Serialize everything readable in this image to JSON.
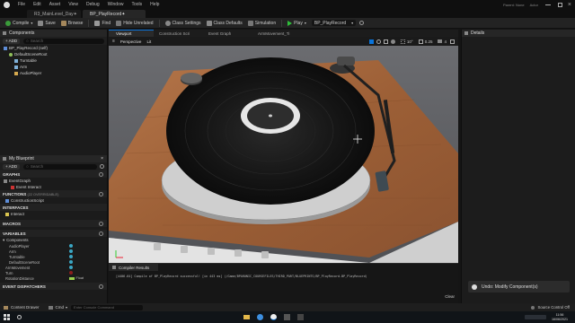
{
  "menubar": {
    "items": [
      "File",
      "Edit",
      "Asset",
      "View",
      "Debug",
      "Window",
      "Tools",
      "Help"
    ],
    "parent_label": "Parent: None",
    "user_badge": "Actor"
  },
  "doc_tabs": [
    "R3_MainLevel_Day✦",
    "BP_PlayRecord✦"
  ],
  "toolbar": {
    "compile": "Compile",
    "save": "Save",
    "browse": "Browse",
    "find": "Find",
    "hide_unrelated": "Hide Unrelated",
    "class_settings": "Class Settings",
    "class_defaults": "Class Defaults",
    "simulation": "Simulation",
    "play": "Play",
    "debug_object": "BP_PlayRecord"
  },
  "components_panel": {
    "title": "Components",
    "add_label": "+ ADD",
    "search_placeholder": "Search",
    "items": [
      "BP_PlayRecord (self)",
      "DefaultSceneRoot",
      "Turntable",
      "Arm",
      "AudioPlayer"
    ]
  },
  "my_blueprint": {
    "title": "My Blueprint",
    "add_label": "+ ADD",
    "search_placeholder": "Search",
    "graphs_label": "GRAPHS",
    "event_graph": "EventGraph",
    "event_interact": "Event Interact",
    "functions_label": "FUNCTIONS",
    "functions_count": "(22 OVERRIDABLE)",
    "construction_script": "ConstructionScript",
    "interfaces_label": "INTERFACES",
    "interact": "Interact",
    "macros_label": "MACROS",
    "variables_label": "VARIABLES",
    "components_label": "Components",
    "variables": [
      "AudioPlayer",
      "Arm",
      "Turntable",
      "DefaultSceneRoot",
      "ArmMovement",
      "Turn",
      "RotationDistance"
    ],
    "variable_type": "Float",
    "event_dispatchers_label": "EVENT DISPATCHERS"
  },
  "editor_tabs": [
    "Viewport",
    "Construction Scri",
    "Event Graph",
    "ArmMovement_Ti"
  ],
  "viewport": {
    "perspective": "Perspective",
    "lit": "Lit",
    "angle": "10°",
    "scale": "0.25",
    "camera_speed": "4"
  },
  "compiler": {
    "tab_label": "Compiler Results",
    "message": "[4406.64] Compile of BP_PlayRecord successful! [in 443 ms] (/Game/BPARONIC_COURSEFILES/THIRD_PART/BLUEPRINTS/BP_PlayRecord.BP_PlayRecord)",
    "clear_label": "Clear"
  },
  "details_panel": {
    "title": "Details"
  },
  "toast": {
    "text": "Undo: Modify Component(s)"
  },
  "bottombar": {
    "content_drawer": "Content Drawer",
    "cmd": "Cmd",
    "console_placeholder": "Enter Console Command",
    "source_control": "Source Control Off"
  },
  "taskbar": {
    "time": "11:56",
    "date": "16/06/2021"
  },
  "colors": {
    "accent": "#0a74da",
    "play_green": "#2fbf3a",
    "panel": "#1b1b1b",
    "wood": "#a0643a"
  }
}
